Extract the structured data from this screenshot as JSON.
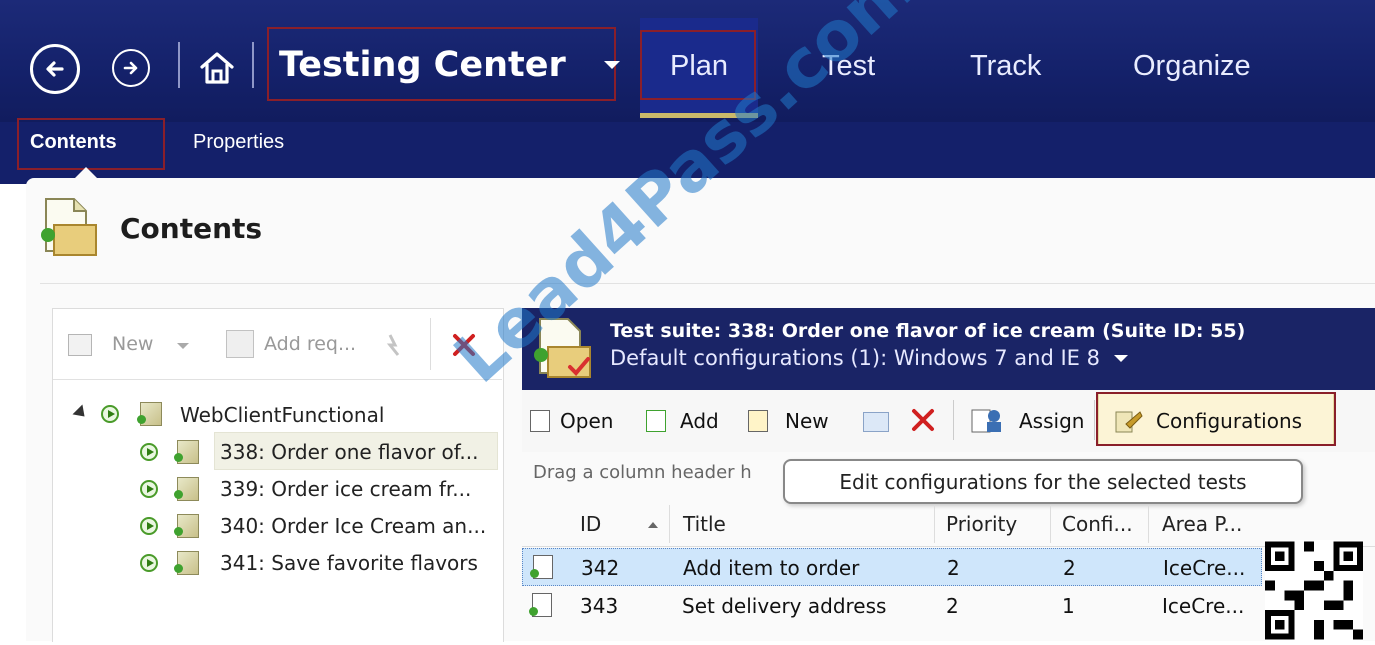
{
  "topbar": {
    "title": "Testing Center",
    "nav_tabs": [
      {
        "label": "Plan"
      },
      {
        "label": "Test"
      },
      {
        "label": "Track"
      },
      {
        "label": "Organize"
      }
    ]
  },
  "subbar": {
    "tabs": [
      {
        "label": "Contents"
      },
      {
        "label": "Properties"
      }
    ]
  },
  "panel": {
    "title": "Contents"
  },
  "left_pane": {
    "toolbar": {
      "new_label": "New",
      "add_req_label": "Add req..."
    },
    "tree": {
      "root": "WebClientFunctional",
      "items": [
        {
          "label": "338: Order one flavor of..."
        },
        {
          "label": "339: Order ice cream fr..."
        },
        {
          "label": "340: Order Ice Cream an..."
        },
        {
          "label": "341: Save favorite flavors"
        }
      ]
    }
  },
  "suite_header": {
    "title": "Test suite: 338: Order one flavor of ice cream (Suite ID: 55)",
    "config": "Default configurations (1):  Windows 7 and IE 8"
  },
  "right_toolbar": {
    "open": "Open",
    "add": "Add",
    "new": "New",
    "assign": "Assign",
    "configurations": "Configurations"
  },
  "group_hint": "Drag a column header h",
  "tooltip": "Edit configurations for the selected tests",
  "grid": {
    "columns": [
      "ID",
      "Title",
      "Priority",
      "Confi...",
      "Area P..."
    ],
    "rows": [
      {
        "id": "342",
        "title": "Add item to order",
        "priority": "2",
        "config": "2",
        "area": "IceCre..."
      },
      {
        "id": "343",
        "title": "Set delivery address",
        "priority": "2",
        "config": "1",
        "area": "IceCre..."
      }
    ]
  },
  "watermark": "Lead4Pass.com",
  "colors": {
    "header_blue": "#14216a",
    "accent_red": "#8a1f2a",
    "selected_row": "#cfe6fb",
    "watermark": "#2178c8"
  }
}
